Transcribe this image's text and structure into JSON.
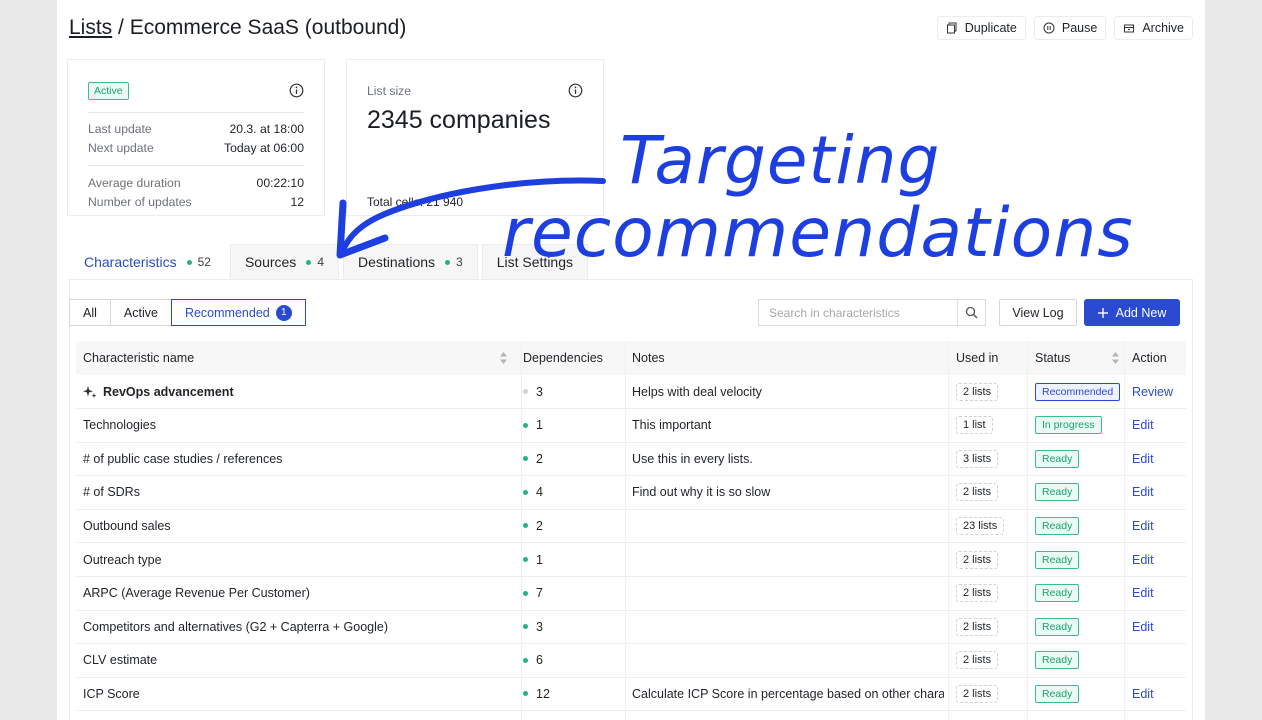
{
  "header": {
    "breadcrumb_link": "Lists",
    "breadcrumb_sep": " / ",
    "title": "Ecommerce SaaS (outbound)",
    "actions": [
      {
        "label": "Duplicate",
        "icon": "copy-icon"
      },
      {
        "label": "Pause",
        "icon": "pause-icon"
      },
      {
        "label": "Archive",
        "icon": "archive-icon"
      }
    ]
  },
  "status_card": {
    "badge": "Active",
    "last_update_label": "Last update",
    "last_update_value": "20.3. at 18:00",
    "next_update_label": "Next update",
    "next_update_value": "Today at 06:00",
    "avg_duration_label": "Average duration",
    "avg_duration_value": "00:22:10",
    "num_updates_label": "Number of updates",
    "num_updates_value": "12"
  },
  "size_card": {
    "label": "List size",
    "value": "2345 companies",
    "footer": "Total cells: 21 940"
  },
  "tabs": [
    {
      "label": "Characteristics",
      "count": "52"
    },
    {
      "label": "Sources",
      "count": "4"
    },
    {
      "label": "Destinations",
      "count": "3"
    },
    {
      "label": "List Settings",
      "count": ""
    }
  ],
  "filters": {
    "all": "All",
    "active": "Active",
    "recommended": "Recommended",
    "recommended_count": "1"
  },
  "search": {
    "placeholder": "Search in characteristics"
  },
  "buttons": {
    "view_log": "View Log",
    "add_new": "Add New"
  },
  "table": {
    "columns": [
      "Characteristic name",
      "Dependencies",
      "Notes",
      "Used in",
      "Status",
      "Action"
    ],
    "rows": [
      {
        "name": "RevOps advancement",
        "deps": "3",
        "notes": "Helps with deal velocity",
        "used": "2 lists",
        "status": "Recommended",
        "action": "Review"
      },
      {
        "name": "Technologies",
        "deps": "1",
        "notes": "This important",
        "used": "1 list",
        "status": "In progress",
        "action": "Edit"
      },
      {
        "name": "# of public case studies / references",
        "deps": "2",
        "notes": "Use this in every lists.",
        "used": "3 lists",
        "status": "Ready",
        "action": "Edit"
      },
      {
        "name": "# of SDRs",
        "deps": "4",
        "notes": "Find out why it is so slow",
        "used": "2 lists",
        "status": "Ready",
        "action": "Edit"
      },
      {
        "name": "Outbound sales",
        "deps": "2",
        "notes": "",
        "used": "23 lists",
        "status": "Ready",
        "action": "Edit"
      },
      {
        "name": "Outreach type",
        "deps": "1",
        "notes": "",
        "used": "2 lists",
        "status": "Ready",
        "action": "Edit"
      },
      {
        "name": "ARPC (Average Revenue Per Customer)",
        "deps": "7",
        "notes": "",
        "used": "2 lists",
        "status": "Ready",
        "action": "Edit"
      },
      {
        "name": "Competitors and alternatives (G2 + Capterra + Google)",
        "deps": "3",
        "notes": "",
        "used": "2 lists",
        "status": "Ready",
        "action": "Edit"
      },
      {
        "name": "CLV estimate",
        "deps": "6",
        "notes": "",
        "used": "2 lists",
        "status": "Ready",
        "action": ""
      },
      {
        "name": "ICP Score",
        "deps": "12",
        "notes": "Calculate ICP Score in percentage based on other charac",
        "used": "2 lists",
        "status": "Ready",
        "action": "Edit"
      }
    ]
  },
  "annotation": {
    "line1": "Targeting",
    "line2": "recommendations"
  },
  "colors": {
    "accent": "#2a4bd1",
    "ready": "#19a36d",
    "annotation": "#1d3fe0"
  }
}
